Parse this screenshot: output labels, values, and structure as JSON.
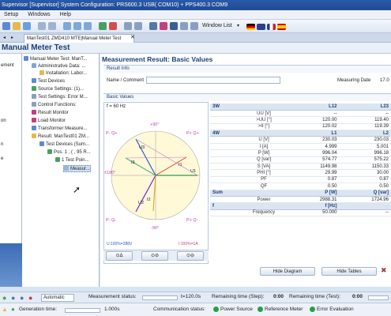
{
  "window": {
    "title": "Supervisor [Supervisor] System Configuration: PRS600.3 USB( COM10) + PPS400.3 COM9"
  },
  "menu": {
    "items": [
      "Setup",
      "Windows",
      "Help"
    ]
  },
  "toolbar": {
    "window_list_label": "Window List"
  },
  "tab": {
    "label": "ManTest01 ZMD410 MTE|Manual Meter Test"
  },
  "page": {
    "title": "Manual Meter Test"
  },
  "left_panel": {
    "items": [
      "ement",
      "on",
      "n",
      "e"
    ]
  },
  "tree": {
    "items": [
      "Manual Meter Test: ManT...",
      "Administrative Data: ...",
      "Installation: Labor...",
      "Test Devices",
      "Source Settings: (1)...",
      "Test Settings: Error M...",
      "Control Functions:",
      "Result Monitor",
      "Load Monitor",
      "Transformer Measure...",
      "Result: ManTest01 ZM...",
      "Test Devices (Sum...",
      "Pos. 1 , ( , 95 R...",
      "1 Test Poin...",
      "Measur..."
    ]
  },
  "main": {
    "title": "Measurement Result: Basic Values",
    "result_info_label": "Result Info",
    "name_label": "Name / Comment",
    "measuring_date_label": "Measuring Date",
    "measuring_date_value": "17.0",
    "basic_values_label": "Basic Values"
  },
  "diagram": {
    "freq_label": "f = 60 Hz",
    "angle_top": "+90°",
    "angle_left": "±180°",
    "angle_bottom": "-90°",
    "quad_tl": "P- Q+",
    "quad_tr": "P+ Q+",
    "quad_bl": "P- Q-",
    "quad_br": "P+ Q-",
    "vectors": [
      "U3",
      "U2",
      "U1",
      "I3",
      "I2",
      "I1"
    ],
    "scale_left": "U:100%=288V",
    "scale_right": "I:100%=1A"
  },
  "table": {
    "rows": [
      {
        "type": "head",
        "cells": [
          "3W",
          "",
          "L12",
          "L23"
        ]
      },
      {
        "type": "row",
        "cells": [
          "",
          "UU [V]",
          "--",
          "--"
        ]
      },
      {
        "type": "row",
        "cells": [
          "",
          ">UU [°]",
          "120.00",
          "119.40"
        ]
      },
      {
        "type": "row",
        "cells": [
          "",
          ">II [°]",
          "120.02",
          "119.39"
        ]
      },
      {
        "type": "head",
        "cells": [
          "4W",
          "",
          "L1",
          "L2"
        ]
      },
      {
        "type": "row",
        "cells": [
          "",
          "U [V]",
          "230.03",
          "230.03"
        ]
      },
      {
        "type": "row",
        "cells": [
          "",
          "I [A]",
          "4.999",
          "5.001"
        ]
      },
      {
        "type": "row",
        "cells": [
          "",
          "P [W]",
          "996.04",
          "996.18"
        ]
      },
      {
        "type": "row",
        "cells": [
          "",
          "Q [var]",
          "574.77",
          "575.22"
        ]
      },
      {
        "type": "row",
        "cells": [
          "",
          "S [VA]",
          "1149.98",
          "1150.33"
        ]
      },
      {
        "type": "row",
        "cells": [
          "",
          "PHI [°]",
          "29.99",
          "30.00"
        ]
      },
      {
        "type": "row",
        "cells": [
          "",
          "PF",
          "0.87",
          "0.87"
        ]
      },
      {
        "type": "row",
        "cells": [
          "",
          "QF",
          "0.50",
          "0.50"
        ]
      },
      {
        "type": "head",
        "cells": [
          "Sum",
          "",
          "P [W]",
          "Q [var]"
        ]
      },
      {
        "type": "row",
        "cells": [
          "",
          "Power",
          "2988.31",
          "1724.96"
        ]
      },
      {
        "type": "head",
        "cells": [
          "f",
          "",
          "f [Hz]",
          ""
        ]
      },
      {
        "type": "row",
        "cells": [
          "",
          "Frequency",
          "50.000",
          "--"
        ]
      }
    ]
  },
  "buttons": {
    "hide_diagram": "Hide Diagram",
    "hide_tables": "Hide Tables"
  },
  "playbar": {
    "mode_value": "Automatic",
    "measurement_status_label": "Measurement status:",
    "elapsed": "t=120.0s",
    "remaining_step_label": "Remaining time (Step):",
    "remaining_step_value": "0:00",
    "remaining_test_label": "Remaining time (Test):",
    "remaining_test_value": "0:00"
  },
  "statusbar": {
    "generation_time_label": "Generation time:",
    "generation_time_value": "1.000s",
    "communication_status_label": "Communication status:",
    "power_source": "Power Source",
    "reference_meter": "Reference Meter",
    "error_evaluation": "Error Evaluation"
  },
  "colors": {
    "accent": "#1c3f78",
    "u1": "#2a9d4a",
    "u2": "#7a1fd0",
    "u3": "#2a5ad0",
    "i1": "#e83a3a",
    "i2": "#d4a300",
    "i3": "#2aa06a"
  }
}
